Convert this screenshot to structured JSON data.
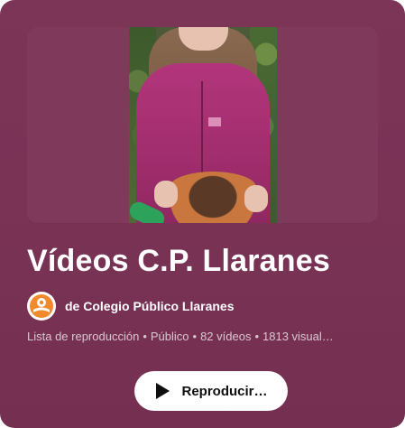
{
  "playlist": {
    "title": "Vídeos C.P. Llaranes",
    "channel_name": "de Colegio Público Llaranes",
    "meta": {
      "type": "Lista de reproducción",
      "visibility": "Público",
      "videos": "82 vídeos",
      "views": "1813 visual…",
      "separator": "•"
    },
    "play_button_label": "Reproducir…"
  },
  "icons": {
    "play": "play-icon",
    "channel_avatar": "colegio-logo-icon"
  },
  "colors": {
    "card_background": "#7a3355",
    "button_background": "#ffffff",
    "avatar_accent": "#f08a2c"
  }
}
